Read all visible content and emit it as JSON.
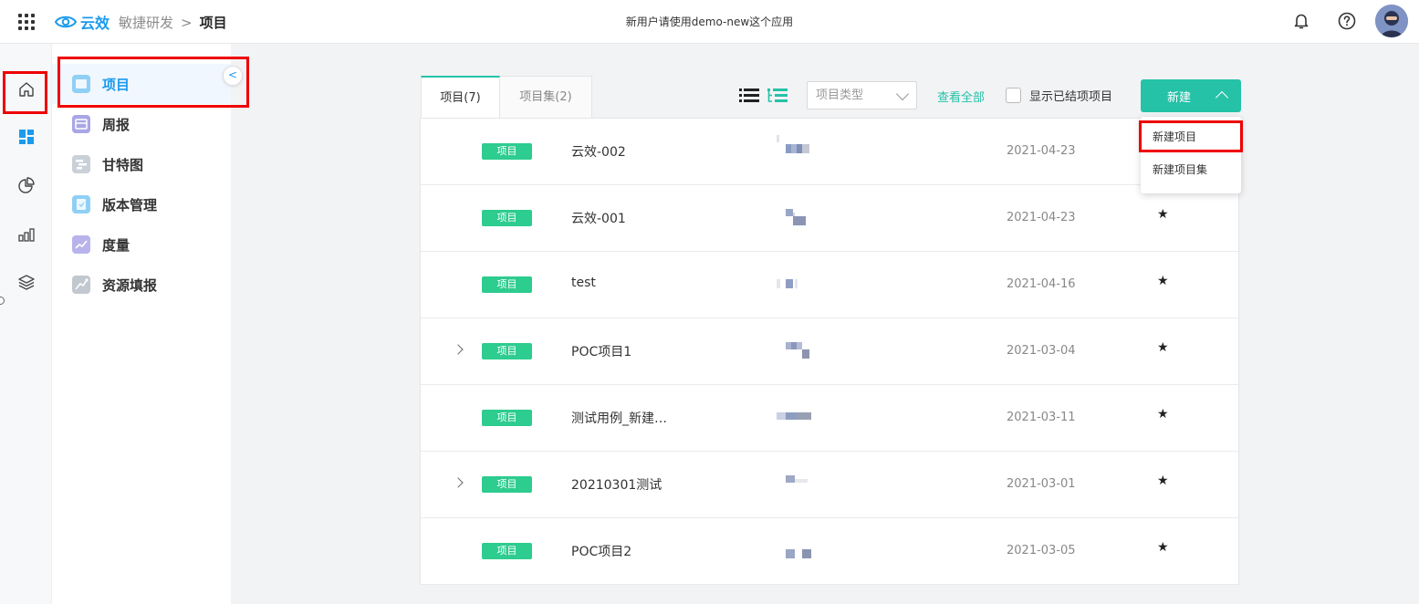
{
  "header": {
    "app_name": "云效",
    "breadcrumb": [
      "敏捷研发",
      ">",
      "项目"
    ],
    "notice": "新用户请使用demo-new这个应用"
  },
  "rail": {
    "items": [
      {
        "icon": "home-icon"
      },
      {
        "icon": "dashboard-icon",
        "active": true
      },
      {
        "icon": "pie-chart-icon"
      },
      {
        "icon": "bar-chart-icon"
      },
      {
        "icon": "layers-icon"
      }
    ]
  },
  "sidebar": {
    "items": [
      {
        "label": "项目",
        "icon": "folder-icon",
        "color": "#8fd0f5",
        "active": true
      },
      {
        "label": "周报",
        "icon": "calendar-icon",
        "color": "#a9a6e6"
      },
      {
        "label": "甘特图",
        "icon": "gantt-icon",
        "color": "#c9d0d8"
      },
      {
        "label": "版本管理",
        "icon": "version-icon",
        "color": "#8fd0f5"
      },
      {
        "label": "度量",
        "icon": "metrics-icon",
        "color": "#b9b3ec"
      },
      {
        "label": "资源填报",
        "icon": "resource-icon",
        "color": "#c2c8d0"
      }
    ],
    "collapse_glyph": "<"
  },
  "toolbar": {
    "tabs": [
      {
        "label": "项目(7)",
        "active": true
      },
      {
        "label": "项目集(2)",
        "active": false
      }
    ],
    "type_select_placeholder": "项目类型",
    "view_all": "查看全部",
    "show_closed": "显示已结项项目",
    "new_button": "新建"
  },
  "dropdown": {
    "items": [
      "新建项目",
      "新建项目集"
    ]
  },
  "projects": [
    {
      "tag": "项目",
      "name": "云效-002",
      "date": "2021-04-23",
      "expandable": false,
      "starred": false
    },
    {
      "tag": "项目",
      "name": "云效-001",
      "date": "2021-04-23",
      "expandable": false,
      "starred": true
    },
    {
      "tag": "项目",
      "name": "test",
      "date": "2021-04-16",
      "expandable": false,
      "starred": true
    },
    {
      "tag": "项目",
      "name": "POC项目1",
      "date": "2021-03-04",
      "expandable": true,
      "starred": true
    },
    {
      "tag": "项目",
      "name": "测试用例_新建…",
      "date": "2021-03-11",
      "expandable": false,
      "starred": true
    },
    {
      "tag": "项目",
      "name": "20210301测试",
      "date": "2021-03-01",
      "expandable": true,
      "starred": true
    },
    {
      "tag": "项目",
      "name": "POC项目2",
      "date": "2021-03-05",
      "expandable": false,
      "starred": true
    }
  ],
  "colors": {
    "accent": "#25c2a8",
    "tag": "#2dcc8f",
    "brand": "#1b9aee",
    "highlight": "#e00000"
  }
}
